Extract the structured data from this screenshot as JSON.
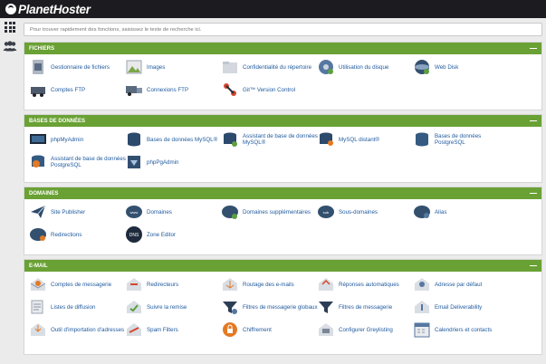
{
  "brand": {
    "name": "PlanetHoster"
  },
  "search": {
    "placeholder": "Pour trouver rapidement des fonctions, saisissez le texte de recherche ici."
  },
  "colors": {
    "topbar": "#1b1b20",
    "panel_header": "#6aa134",
    "link": "#1f5a9e"
  },
  "panels": [
    {
      "title": "FICHIERS",
      "items": [
        {
          "label": "Gestionnaire de fichiers",
          "icon": "file-manager-icon"
        },
        {
          "label": "Images",
          "icon": "images-icon"
        },
        {
          "label": "Confidentialité du répertoire",
          "icon": "directory-privacy-icon"
        },
        {
          "label": "Utilisation du disque",
          "icon": "disk-usage-icon"
        },
        {
          "label": "Web Disk",
          "icon": "web-disk-icon"
        },
        {
          "label": "Comptes FTP",
          "icon": "ftp-accounts-icon"
        },
        {
          "label": "Connexions FTP",
          "icon": "ftp-connections-icon"
        },
        {
          "label": "Git™ Version Control",
          "icon": "git-icon"
        }
      ]
    },
    {
      "title": "BASES DE DONNÉES",
      "items": [
        {
          "label": "phpMyAdmin",
          "icon": "phpmyadmin-icon"
        },
        {
          "label": "Bases de données MySQL®",
          "icon": "mysql-databases-icon"
        },
        {
          "label": "Assistant de base de données MySQL®",
          "icon": "mysql-wizard-icon"
        },
        {
          "label": "MySQL distant®",
          "icon": "remote-mysql-icon"
        },
        {
          "label": "Bases de données PostgreSQL",
          "icon": "postgresql-databases-icon"
        },
        {
          "label": "Assistant de base de données PostgreSQL",
          "icon": "postgresql-wizard-icon"
        },
        {
          "label": "phpPgAdmin",
          "icon": "phppgadmin-icon"
        }
      ]
    },
    {
      "title": "DOMAINES",
      "items": [
        {
          "label": "Site Publisher",
          "icon": "site-publisher-icon"
        },
        {
          "label": "Domaines",
          "icon": "domains-icon"
        },
        {
          "label": "Domaines supplémentaires",
          "icon": "addon-domains-icon"
        },
        {
          "label": "Sous-domaines",
          "icon": "subdomains-icon"
        },
        {
          "label": "Alias",
          "icon": "aliases-icon"
        },
        {
          "label": "Redirections",
          "icon": "redirects-icon"
        },
        {
          "label": "Zone Editor",
          "icon": "zone-editor-icon"
        }
      ]
    },
    {
      "title": "E-MAIL",
      "items": [
        {
          "label": "Comptes de messagerie",
          "icon": "email-accounts-icon"
        },
        {
          "label": "Redirecteurs",
          "icon": "forwarders-icon"
        },
        {
          "label": "Routage des e-mails",
          "icon": "email-routing-icon"
        },
        {
          "label": "Réponses automatiques",
          "icon": "autoresponders-icon"
        },
        {
          "label": "Adresse par défaut",
          "icon": "default-address-icon"
        },
        {
          "label": "Listes de diffusion",
          "icon": "mailing-lists-icon"
        },
        {
          "label": "Suivre la remise",
          "icon": "track-delivery-icon"
        },
        {
          "label": "Filtres de messagerie globaux",
          "icon": "global-filters-icon"
        },
        {
          "label": "Filtres de messagerie",
          "icon": "email-filters-icon"
        },
        {
          "label": "Email Deliverability",
          "icon": "email-deliverability-icon"
        },
        {
          "label": "Outil d'importation d'adresses",
          "icon": "address-importer-icon"
        },
        {
          "label": "Spam Filters",
          "icon": "spam-filters-icon"
        },
        {
          "label": "Chiffrement",
          "icon": "encryption-icon"
        },
        {
          "label": "Configurer Greylisting",
          "icon": "greylisting-icon"
        },
        {
          "label": "Calendriers et contacts",
          "icon": "calendars-contacts-icon"
        }
      ]
    }
  ]
}
